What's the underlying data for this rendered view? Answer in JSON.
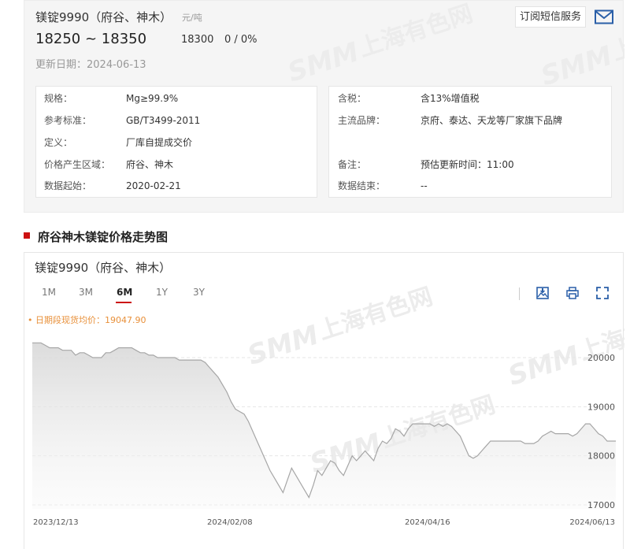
{
  "product": {
    "title": "镁锭9990（府谷、神木）",
    "unit": "元/吨",
    "subscribe_label": "订阅短信服务",
    "mail_icon": "mail-icon",
    "price_range": "18250 ~ 18350",
    "price_avg": "18300",
    "price_change": "0 / 0%",
    "update_date": "更新日期：2024-06-13"
  },
  "specs_left": [
    {
      "key": "规格：",
      "value": "Mg≥99.9%"
    },
    {
      "key": "参考标准：",
      "value": "GB/T3499-2011"
    },
    {
      "key": "定义：",
      "value": "厂库自提成交价"
    },
    {
      "key": "价格产生区域：",
      "value": "府谷、神木"
    },
    {
      "key": "数据起始：",
      "value": "2020-02-21"
    }
  ],
  "specs_right": [
    {
      "key": "含税：",
      "value": "含13%增值税"
    },
    {
      "key": "主流品牌：",
      "value": "京府、泰达、天龙等厂家旗下品牌"
    },
    {
      "key": "备注：",
      "value": "预估更新时间：11:00"
    },
    {
      "key": "数据结束：",
      "value": "--"
    }
  ],
  "section": {
    "title": "府谷神木镁锭价格走势图"
  },
  "chart_panel": {
    "title": "镁锭9990（府谷、神木）",
    "range_tabs": [
      "1M",
      "3M",
      "6M",
      "1Y",
      "3Y"
    ],
    "active_tab": "6M",
    "avg_label": "• 日期段现货均价：19047.90",
    "tools": [
      "download-image-icon",
      "print-icon",
      "fullscreen-icon"
    ]
  },
  "watermark": {
    "brand": "SMM",
    "text": "上海有色网"
  },
  "colors": {
    "accent": "#cc1111",
    "avg_label": "#e8903a",
    "line": "#a6a6a6",
    "area_top": "#dcdcdc"
  },
  "chart_data": {
    "type": "area",
    "title": "",
    "ylim": [
      16900,
      20400
    ],
    "yticks": [
      20000,
      19000,
      18000,
      17000
    ],
    "xtick_labels": [
      "2023/12/13",
      "2024/02/08",
      "2024/04/16",
      "2024/06/13"
    ],
    "grid": true,
    "series": [
      {
        "values": [
          20300,
          20300,
          20300,
          20250,
          20200,
          20200,
          20200,
          20150,
          20150,
          20150,
          20050,
          20100,
          20100,
          20050,
          20000,
          20000,
          20000,
          20100,
          20100,
          20150,
          20200,
          20200,
          20200,
          20200,
          20150,
          20100,
          20100,
          20050,
          20050,
          20000,
          20000,
          20000,
          20000,
          20000,
          19950,
          19950,
          19950,
          19950,
          19950,
          19950,
          19900,
          19800,
          19700,
          19600,
          19450,
          19300,
          19100,
          18950,
          18900,
          18850,
          18700,
          18500,
          18300,
          18100,
          17900,
          17700,
          17550,
          17400,
          17250,
          17500,
          17750,
          17600,
          17450,
          17300,
          17150,
          17400,
          17700,
          17600,
          17750,
          17900,
          17850,
          17700,
          17600,
          17800,
          18000,
          17900,
          18000,
          18100,
          18000,
          17900,
          18150,
          18300,
          18250,
          18350,
          18550,
          18500,
          18400,
          18550,
          18650,
          18650,
          18650,
          18650,
          18650,
          18600,
          18650,
          18600,
          18650,
          18600,
          18500,
          18400,
          18200,
          18000,
          17950,
          18000,
          18100,
          18200,
          18300,
          18300,
          18300,
          18300,
          18300,
          18300,
          18300,
          18300,
          18250,
          18250,
          18250,
          18300,
          18400,
          18450,
          18500,
          18450,
          18450,
          18450,
          18450,
          18400,
          18450,
          18550,
          18650,
          18650,
          18550,
          18450,
          18400,
          18300,
          18300,
          18300
        ]
      }
    ]
  }
}
